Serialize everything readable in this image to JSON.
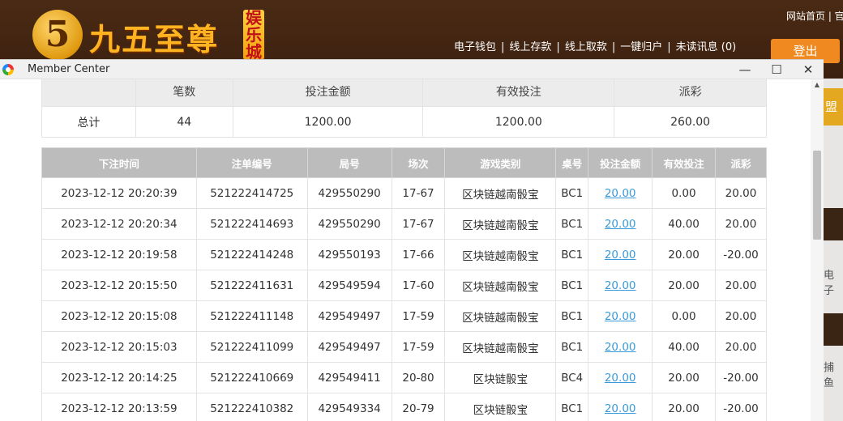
{
  "site": {
    "logo_char": "5",
    "logo_text": "九五至尊",
    "logo_tag": "娱乐城",
    "top_link": "网站首页 | 官",
    "nav": [
      "电子钱包",
      "线上存款",
      "线上取款",
      "一键归户",
      "未读讯息 (0)"
    ],
    "logout": "登出",
    "side_tab": "盟",
    "side_labels": [
      "电子",
      "捕鱼"
    ]
  },
  "window": {
    "title": "Member Center",
    "minimize": "—",
    "maximize": "☐",
    "close": "✕"
  },
  "summary": {
    "headers": [
      "",
      "笔数",
      "投注金额",
      "有效投注",
      "派彩"
    ],
    "row": {
      "label": "总计",
      "count": "44",
      "bet": "1200.00",
      "valid": "1200.00",
      "payout": "260.00"
    }
  },
  "bets": {
    "headers": [
      "下注时间",
      "注单编号",
      "局号",
      "场次",
      "游戏类别",
      "桌号",
      "投注金额",
      "有效投注",
      "派彩"
    ],
    "rows": [
      {
        "time": "2023-12-12 20:20:39",
        "id": "521222414725",
        "round": "429550290",
        "session": "17-67",
        "game": "区块链越南骰宝",
        "table": "BC1",
        "bet": "20.00",
        "valid": "0.00",
        "payout": "20.00",
        "neg": false
      },
      {
        "time": "2023-12-12 20:20:34",
        "id": "521222414693",
        "round": "429550290",
        "session": "17-67",
        "game": "区块链越南骰宝",
        "table": "BC1",
        "bet": "20.00",
        "valid": "40.00",
        "payout": "20.00",
        "neg": false
      },
      {
        "time": "2023-12-12 20:19:58",
        "id": "521222414248",
        "round": "429550193",
        "session": "17-66",
        "game": "区块链越南骰宝",
        "table": "BC1",
        "bet": "20.00",
        "valid": "20.00",
        "payout": "-20.00",
        "neg": true
      },
      {
        "time": "2023-12-12 20:15:50",
        "id": "521222411631",
        "round": "429549594",
        "session": "17-60",
        "game": "区块链越南骰宝",
        "table": "BC1",
        "bet": "20.00",
        "valid": "20.00",
        "payout": "20.00",
        "neg": false
      },
      {
        "time": "2023-12-12 20:15:08",
        "id": "521222411148",
        "round": "429549497",
        "session": "17-59",
        "game": "区块链越南骰宝",
        "table": "BC1",
        "bet": "20.00",
        "valid": "0.00",
        "payout": "20.00",
        "neg": false
      },
      {
        "time": "2023-12-12 20:15:03",
        "id": "521222411099",
        "round": "429549497",
        "session": "17-59",
        "game": "区块链越南骰宝",
        "table": "BC1",
        "bet": "20.00",
        "valid": "40.00",
        "payout": "20.00",
        "neg": false
      },
      {
        "time": "2023-12-12 20:14:25",
        "id": "521222410669",
        "round": "429549411",
        "session": "20-80",
        "game": "区块链骰宝",
        "table": "BC4",
        "bet": "20.00",
        "valid": "20.00",
        "payout": "-20.00",
        "neg": true
      },
      {
        "time": "2023-12-12 20:13:59",
        "id": "521222410382",
        "round": "429549334",
        "session": "20-79",
        "game": "区块链骰宝",
        "table": "BC1",
        "bet": "20.00",
        "valid": "20.00",
        "payout": "-20.00",
        "neg": true
      }
    ]
  }
}
